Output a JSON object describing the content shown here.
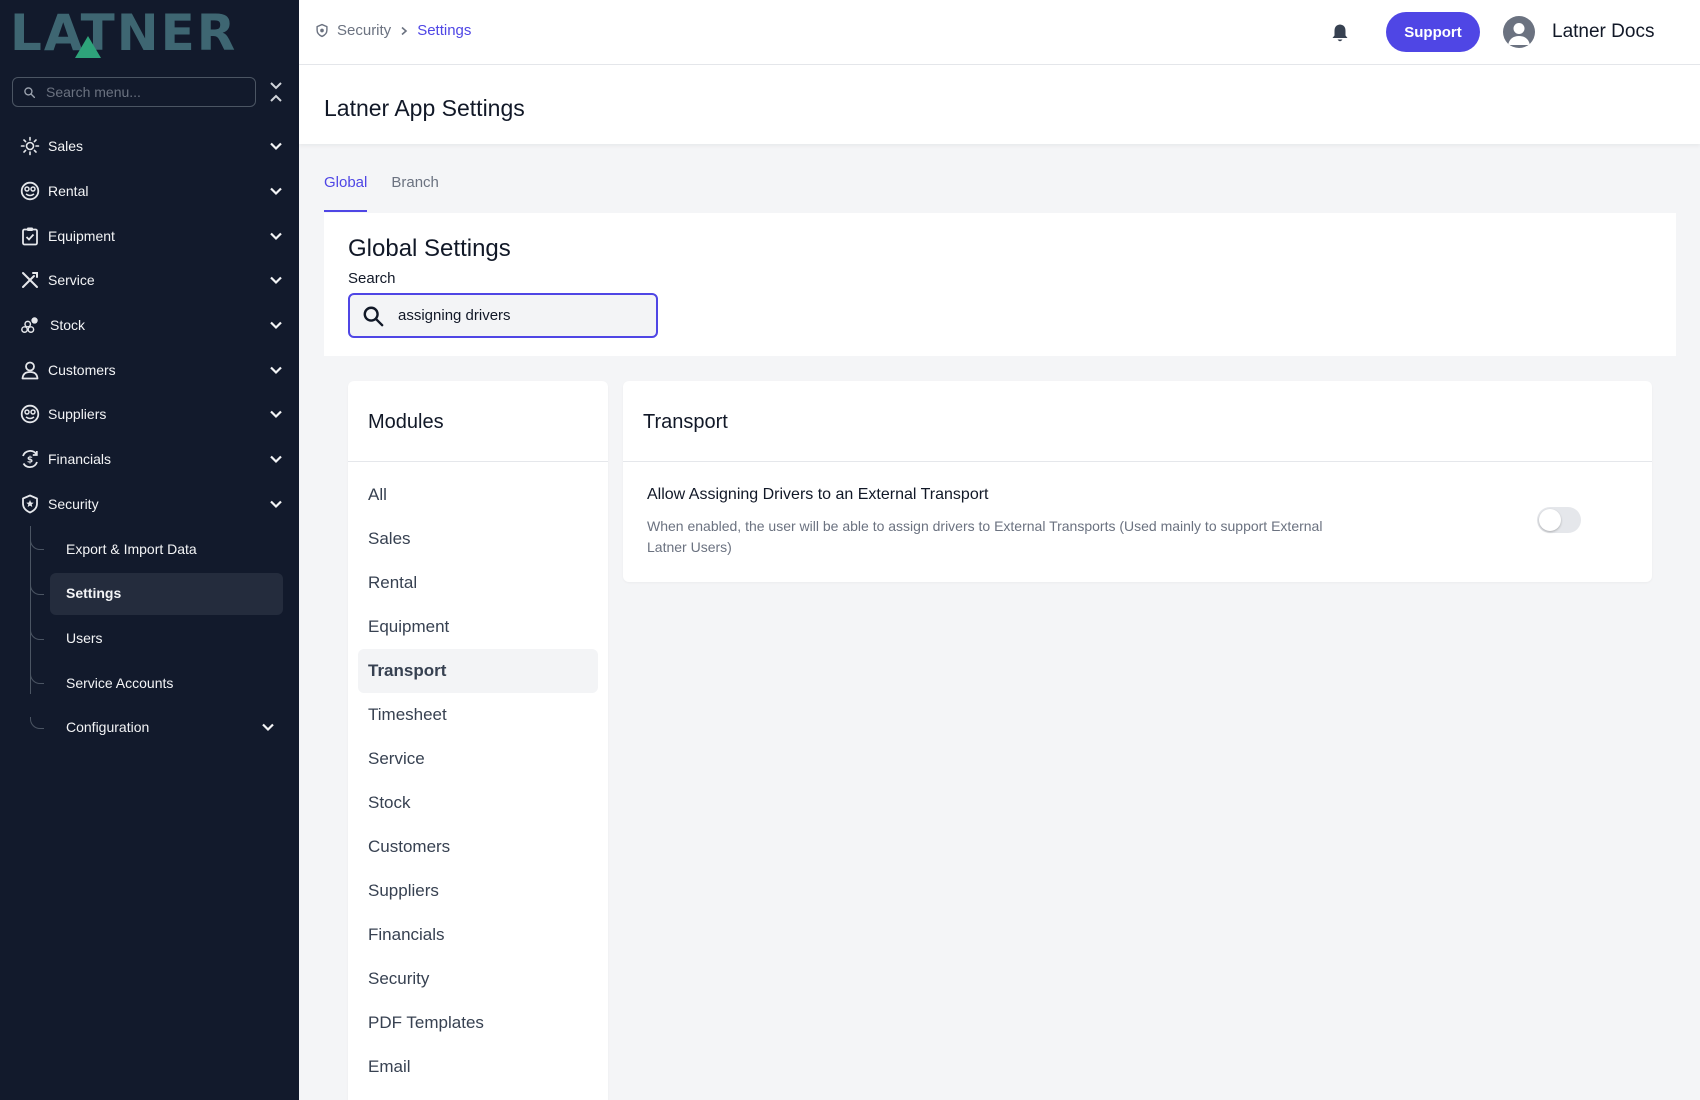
{
  "brand": {
    "logo_text": "LATNER"
  },
  "sidebar": {
    "search_placeholder": "Search menu...",
    "items": [
      {
        "label": "Sales",
        "icon": "sales-icon"
      },
      {
        "label": "Rental",
        "icon": "rental-icon"
      },
      {
        "label": "Equipment",
        "icon": "clipboard-icon"
      },
      {
        "label": "Service",
        "icon": "tools-icon"
      },
      {
        "label": "Stock",
        "icon": "stock-icon"
      },
      {
        "label": "Customers",
        "icon": "user-icon"
      },
      {
        "label": "Suppliers",
        "icon": "suppliers-icon"
      },
      {
        "label": "Financials",
        "icon": "financials-icon"
      },
      {
        "label": "Security",
        "icon": "shield-icon"
      }
    ],
    "security_children": [
      {
        "label": "Export & Import Data"
      },
      {
        "label": "Settings",
        "active": true
      },
      {
        "label": "Users"
      },
      {
        "label": "Service Accounts"
      },
      {
        "label": "Configuration"
      }
    ]
  },
  "topbar": {
    "breadcrumb": [
      "Security",
      "Settings"
    ],
    "support_label": "Support",
    "user_name": "Latner Docs"
  },
  "page": {
    "title": "Latner App Settings",
    "tabs": [
      {
        "label": "Global",
        "active": true
      },
      {
        "label": "Branch",
        "active": false
      }
    ]
  },
  "global_settings": {
    "title": "Global Settings",
    "search_label": "Search",
    "search_value": "assigning drivers"
  },
  "modules": {
    "title": "Modules",
    "items": [
      "All",
      "Sales",
      "Rental",
      "Equipment",
      "Transport",
      "Timesheet",
      "Service",
      "Stock",
      "Customers",
      "Suppliers",
      "Financials",
      "Security",
      "PDF Templates",
      "Email"
    ],
    "active": "Transport"
  },
  "transport": {
    "title": "Transport",
    "setting": {
      "title": "Allow Assigning Drivers to an External Transport",
      "description": "When enabled, the user will be able to assign drivers to External Transports (Used mainly to support External Latner Users)",
      "enabled": false
    }
  },
  "colors": {
    "sidebar_bg": "#121a2c",
    "accent": "#4f46e5",
    "logo_teal": "#3e6672",
    "logo_green": "#2ea37a"
  }
}
